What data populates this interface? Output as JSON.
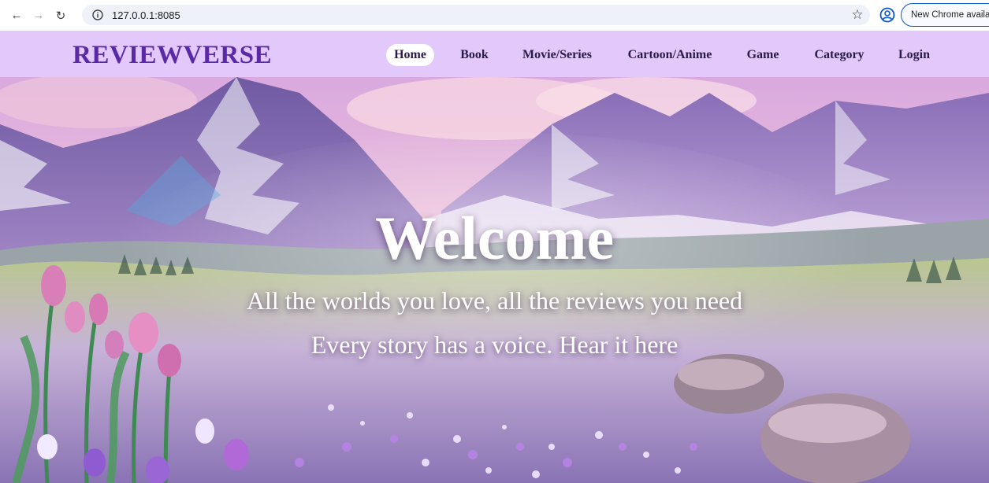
{
  "browser": {
    "url": "127.0.0.1:8085",
    "update_label": "New Chrome available",
    "icons": [
      "back-arrow-icon",
      "forward-arrow-icon",
      "reload-icon",
      "site-info-icon",
      "bookmark-star-icon",
      "profile-icon"
    ]
  },
  "site": {
    "brand": "REVIEWVERSE",
    "nav": [
      {
        "label": "Home",
        "active": true
      },
      {
        "label": "Book"
      },
      {
        "label": "Movie/Series"
      },
      {
        "label": "Cartoon/Anime"
      },
      {
        "label": "Game"
      },
      {
        "label": "Category"
      },
      {
        "label": "Login"
      }
    ],
    "header_color": "#e2c8fb",
    "brand_color": "#5a2aa6"
  },
  "hero": {
    "title": "Welcome",
    "line1": "All the worlds you love, all the reviews you need",
    "line2": "Every story has a voice. Hear it here"
  }
}
